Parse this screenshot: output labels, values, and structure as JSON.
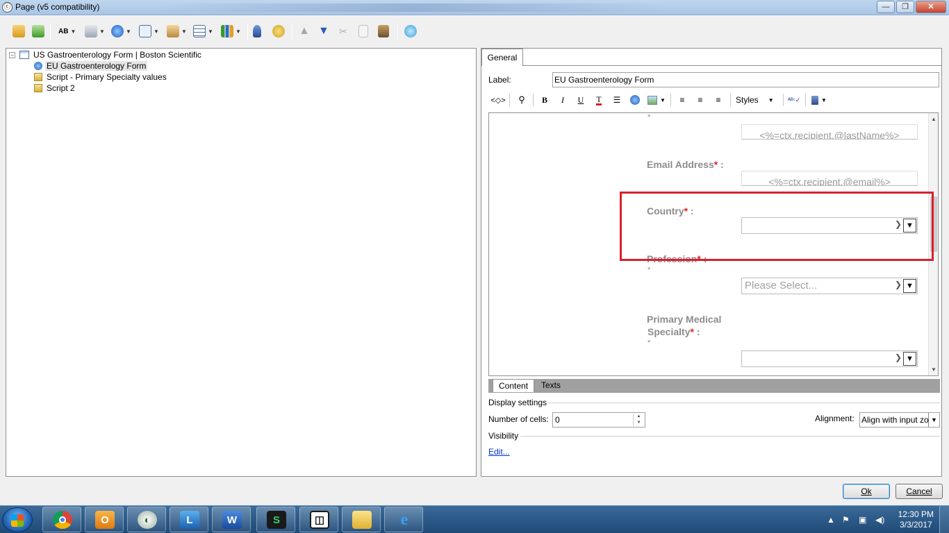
{
  "window": {
    "title": "Page (v5 compatibility)",
    "minimize": "—",
    "maximize": "❐",
    "close": "✕"
  },
  "tree": {
    "root": "US Gastroenterology Form | Boston Scientific",
    "items": [
      {
        "label": "EU Gastroenterology Form",
        "icon": "globe-icon"
      },
      {
        "label": "Script - Primary Specialty values",
        "icon": "script-icon"
      },
      {
        "label": "Script 2",
        "icon": "script-icon"
      }
    ]
  },
  "right": {
    "tab": "General",
    "label_caption": "Label:",
    "label_value": "EU Gastroenterology Form",
    "styles": "Styles"
  },
  "preview": {
    "top_star": "*",
    "email_label": "Email Address",
    "email_placeholder": "<%=ctx.recipient.@email%>",
    "lastname_placeholder": "<%=ctx.recipient.@lastName%>",
    "country_label": "Country",
    "profession_label": "Profession",
    "profession_placeholder": "Please Select...",
    "specialty_label_1": "Primary Medical",
    "specialty_label_2": "Specialty",
    "req": "*",
    "colon": " :",
    "star": "*"
  },
  "bottom_tabs": [
    "Content",
    "Texts"
  ],
  "settings": {
    "display_settings": "Display settings",
    "cells_label": "Number of cells:",
    "cells_value": "0",
    "alignment_label": "Alignment:",
    "alignment_value": "Align with input zone",
    "visibility": "Visibility",
    "edit_link": "Edit..."
  },
  "buttons": {
    "ok": "Ok",
    "cancel": "Cancel"
  },
  "taskbar": {
    "time": "12:30 PM",
    "date": "3/3/2017",
    "apps": [
      "chrome-icon",
      "outlook-icon",
      "app-circle-icon",
      "lync-icon",
      "word-icon",
      "sharefile-icon",
      "app-box-icon",
      "folder-icon",
      "ie-icon"
    ]
  }
}
